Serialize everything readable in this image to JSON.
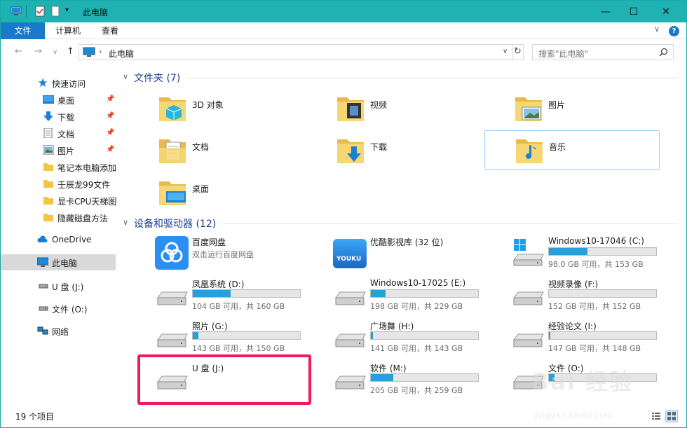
{
  "window": {
    "title": "此电脑",
    "minimize": "—",
    "maximize": "☐",
    "close": "✕"
  },
  "ribbon": {
    "tabs": [
      "文件",
      "计算机",
      "查看"
    ],
    "help": "?"
  },
  "address": {
    "path": "此电脑",
    "search_placeholder": "搜索\"此电脑\""
  },
  "sidebar": {
    "quick_access": "快速访问",
    "items": [
      {
        "label": "桌面",
        "icon": "desktop-icon",
        "pinned": true
      },
      {
        "label": "下载",
        "icon": "download-icon",
        "pinned": true
      },
      {
        "label": "文档",
        "icon": "document-icon",
        "pinned": true
      },
      {
        "label": "图片",
        "icon": "picture-icon",
        "pinned": true
      },
      {
        "label": "笔记本电脑添加",
        "icon": "folder-icon"
      },
      {
        "label": "壬辰龙99文件",
        "icon": "folder-icon"
      },
      {
        "label": "显卡CPU天梯图",
        "icon": "folder-icon"
      },
      {
        "label": "隐藏磁盘方法",
        "icon": "folder-icon"
      }
    ],
    "onedrive": "OneDrive",
    "this_pc": "此电脑",
    "usb": "U 盘 (J:)",
    "files_o": "文件 (O:)",
    "network": "网络"
  },
  "folders": {
    "header": "文件夹 (7)",
    "items": [
      {
        "label": "3D 对象",
        "overlay": "3d-cube-icon"
      },
      {
        "label": "视频",
        "overlay": "film-icon"
      },
      {
        "label": "图片",
        "overlay": "picture-icon"
      },
      {
        "label": "文档",
        "overlay": "document-icon"
      },
      {
        "label": "下载",
        "overlay": "download-arrow-icon"
      },
      {
        "label": "音乐",
        "overlay": "music-note-icon"
      },
      {
        "label": "桌面",
        "overlay": "desktop-icon"
      }
    ]
  },
  "devices": {
    "header": "设备和驱动器 (12)",
    "items": [
      {
        "name": "百度网盘",
        "sub": "双击运行百度网盘",
        "type": "app-baidu"
      },
      {
        "name": "优酷影视库 (32 位)",
        "sub": "",
        "type": "app-youku",
        "logo": "YOUKU"
      },
      {
        "name": "Windows10-17046 (C:)",
        "size": "98.0 GB 可用，共 153 GB",
        "used": 0.36,
        "type": "windows"
      },
      {
        "name": "凤凰系统 (D:)",
        "size": "104 GB 可用，共 160 GB",
        "used": 0.35,
        "type": "drive"
      },
      {
        "name": "Windows10-17025 (E:)",
        "size": "198 GB 可用，共 229 GB",
        "used": 0.14,
        "type": "drive"
      },
      {
        "name": "视频录像 (F:)",
        "size": "152 GB 可用，共 152 GB",
        "used": 0.0,
        "type": "drive"
      },
      {
        "name": "照片 (G:)",
        "size": "143 GB 可用，共 150 GB",
        "used": 0.05,
        "type": "drive"
      },
      {
        "name": "广场舞 (H:)",
        "size": "141 GB 可用，共 143 GB",
        "used": 0.02,
        "type": "drive"
      },
      {
        "name": "经验论文 (I:)",
        "size": "147 GB 可用，共 148 GB",
        "used": 0.01,
        "type": "drive"
      },
      {
        "name": "U 盘 (J:)",
        "size": "",
        "used": null,
        "type": "drive"
      },
      {
        "name": "软件 (M:)",
        "size": "205 GB 可用，共 259 GB",
        "used": 0.21,
        "type": "drive"
      },
      {
        "name": "文件 (O:)",
        "size": "",
        "used": 0.05,
        "type": "drive"
      }
    ]
  },
  "status": {
    "count": "19 个项目"
  },
  "watermark": {
    "text": "Bai 经验",
    "url": "jingyan.baidu.com"
  }
}
